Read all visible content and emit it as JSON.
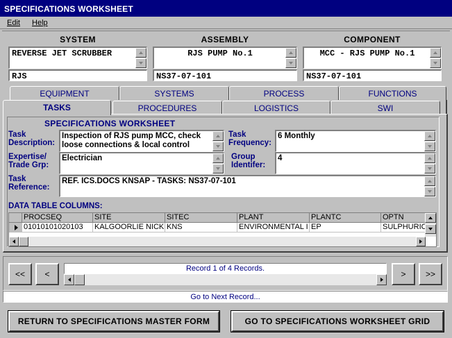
{
  "window": {
    "title": "SPECIFICATIONS WORKSHEET"
  },
  "menu": {
    "edit": "Edit",
    "help": "Help"
  },
  "top": {
    "system": {
      "header": "SYSTEM",
      "name": "REVERSE JET SCRUBBER",
      "code": "RJS"
    },
    "assembly": {
      "header": "ASSEMBLY",
      "name": "RJS PUMP No.1",
      "code": "NS37-07-101"
    },
    "component": {
      "header": "COMPONENT",
      "name": "MCC -  RJS PUMP No.1",
      "code": "NS37-07-101"
    }
  },
  "tabs_back": [
    "EQUIPMENT",
    "SYSTEMS",
    "PROCESS",
    "FUNCTIONS"
  ],
  "tabs_front": [
    "TASKS",
    "PROCEDURES",
    "LOGISTICS",
    "SWI"
  ],
  "worksheet": {
    "heading": "SPECIFICATIONS WORKSHEET",
    "task_description_label": "Task Description:",
    "task_description": "Inspection of RJS pump MCC, check loose connections & local control",
    "task_frequency_label": "Task Frequency:",
    "task_frequency": "6 Monthly",
    "expertise_label": "Expertise/ Trade Grp:",
    "expertise": "Electrician",
    "group_label": "Group Identifer:",
    "group": "4",
    "task_reference_label": "Task Reference:",
    "task_reference": "REF. ICS.DOCS KNSAP - TASKS: NS37-07-101",
    "data_table_label": "DATA TABLE COLUMNS:"
  },
  "table": {
    "columns": [
      "PROCSEQ",
      "SITE",
      "SITEC",
      "PLANT",
      "PLANTC",
      "OPTN"
    ],
    "rows": [
      [
        "01010101020103",
        "KALGOORLIE NICKI",
        "KNS",
        "ENVIRONMENTAL I",
        "EP",
        "SULPHURIC"
      ]
    ]
  },
  "navigator": {
    "first": "<<",
    "prev": "<",
    "next": ">",
    "last": ">>",
    "record_text": "Record 1 of 4 Records.",
    "status": "Go to Next Record..."
  },
  "buttons": {
    "return": "RETURN TO SPECIFICATIONS MASTER FORM",
    "goto_grid": "GO TO SPECIFICATIONS WORKSHEET GRID"
  }
}
